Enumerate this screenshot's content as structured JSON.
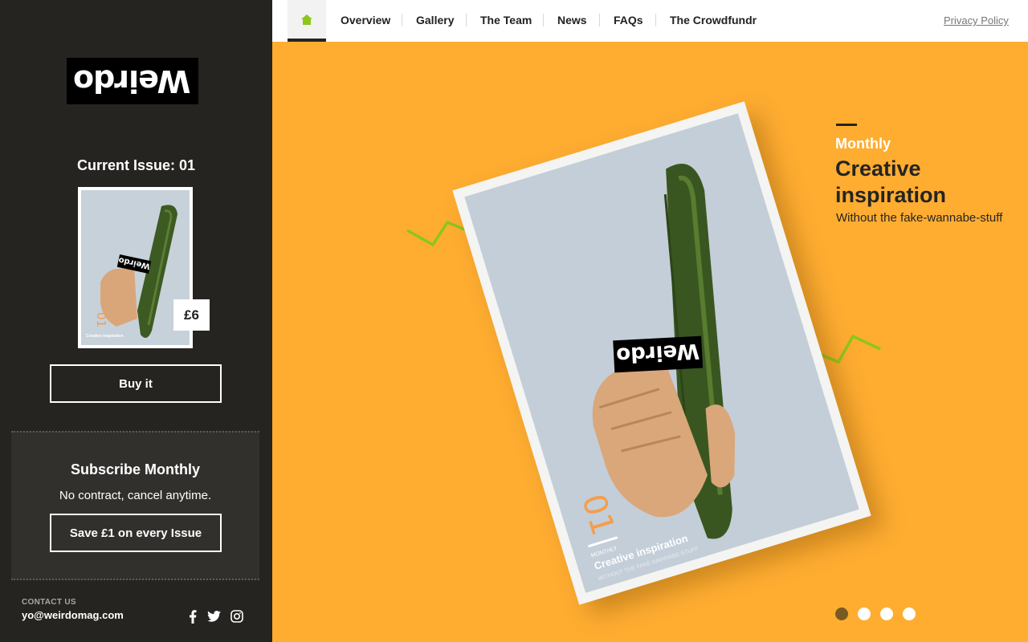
{
  "brand": {
    "logo_text": "Weirdo"
  },
  "sidebar": {
    "issue_title": "Current Issue: 01",
    "price": "£6",
    "buy_label": "Buy it",
    "subscribe": {
      "title": "Subscribe Monthly",
      "description": "No contract, cancel anytime.",
      "button_label": "Save £1 on every Issue"
    },
    "contact": {
      "label": "CONTACT US",
      "email": "yo@weirdomag.com"
    },
    "social_icons": [
      "facebook-icon",
      "twitter-icon",
      "instagram-icon"
    ]
  },
  "nav": {
    "home_icon": "home-icon",
    "items": [
      {
        "label": "Overview"
      },
      {
        "label": "Gallery"
      },
      {
        "label": "The Team"
      },
      {
        "label": "News"
      },
      {
        "label": "FAQs"
      },
      {
        "label": "The Crowdfundr"
      }
    ],
    "privacy_label": "Privacy Policy"
  },
  "hero": {
    "eyebrow": "Monthly",
    "title": "Creative inspiration",
    "subtitle": "Without the fake-wannabe-stuff",
    "cover": {
      "issue_number": "01",
      "label_small": "MONTHLY",
      "label_title": "Creative inspiration",
      "label_sub": "WITHOUT THE FAKE-WANNABE-STUFF"
    },
    "slides": {
      "count": 4,
      "active": 1
    }
  },
  "colors": {
    "sidebar_bg": "#252421",
    "hero_bg": "#fead31",
    "accent_green": "#8cc61c",
    "accent_orange": "#f59d4c"
  }
}
